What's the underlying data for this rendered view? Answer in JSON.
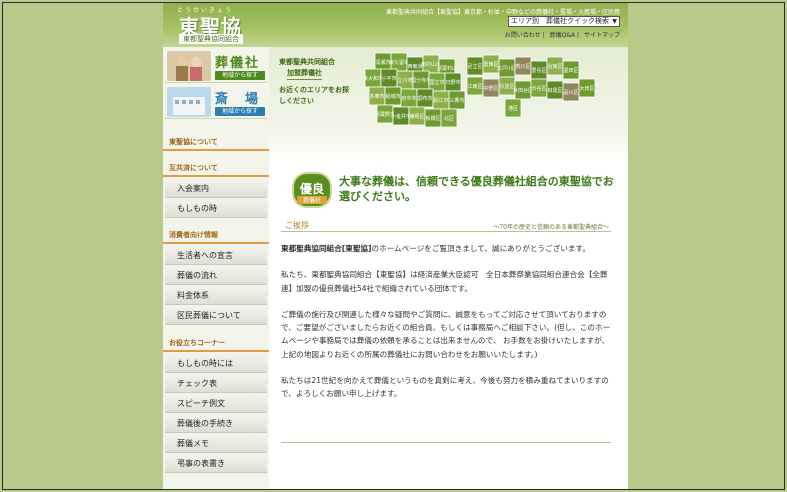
{
  "header": {
    "logo_ruby": "とうせいきょう",
    "logo": "東聖協",
    "logo_sub": "東都聖典協同組合",
    "tagline": "東都聖典共同組合【東聖協】東京都・杉並・中野などの葬儀社・霊場・火葬場・区民葬",
    "area_select": "エリア別　葬儀社クイック検索",
    "util_links": [
      "お問い合わせ",
      "葬儀Q&A",
      "サイトマップ"
    ]
  },
  "sidebar": {
    "promos": [
      {
        "title": "葬儀社",
        "sub": "地域から探す",
        "color": "#4f8a1c"
      },
      {
        "title": "斎　場",
        "sub": "地域から探す",
        "color": "#2e7db3"
      }
    ],
    "sections": [
      {
        "title": "東聖協について",
        "items": []
      },
      {
        "title": "互共済について",
        "items": [
          "入会案内",
          "もしもの時"
        ]
      },
      {
        "title": "消費者向け情報",
        "items": [
          "生活者への宣言",
          "葬儀の流れ",
          "料金体系",
          "区民葬儀について"
        ]
      },
      {
        "title": "お役立ちコーナー",
        "items": [
          "もしもの時には",
          "チェック表",
          "スピーチ例文",
          "葬儀後の手続き",
          "葬儀メモ",
          "弔事の表書き"
        ]
      }
    ]
  },
  "main": {
    "map_label_1": "東都聖典共同組合",
    "map_label_2": "加盟葬儀社",
    "map_guide": "お近くのエリアをお探しください",
    "badge_top": "優良",
    "badge_bottom": "葬儀社",
    "headline": "大事な葬儀は、信頼できる優良葬儀社組合の東聖協でお選びください。",
    "greeting_title": "ご挨拶",
    "greeting_sub": "〜70年の歴史と信頼のある東都聖典組合〜",
    "para1_bold": "東都聖典協同組合[東聖協]",
    "para1_rest": "のホームページをご覧頂きまして、誠にありがとうございます。",
    "para2": "私たち、東都聖典協同組合【東聖協】は経済産業大臣認可　全日本葬祭業協同組合連合会【全葬連】加盟の優良葬儀社54社で組織されている団体です。",
    "para3": "ご葬儀の施行及び関連した様々な疑問やご質問に、誠意をもってご対応させて頂いておりますので、ご要望がございましたらお近くの組合員、もしくは事務局へご相談下さい。(但し、このホームページや事務局では葬儀の依頼を承ることは出来ませんので、 お手数をお掛けいたしますが、上記の地図よりお近くの所属の葬儀社にお問い合わせをお願いいたします。)",
    "para4": "私たちは21世紀を向かえて葬儀というものを真剣に考え、今後も努力を積み重ねてまいりますので、よろしくお願い申し上げます。"
  },
  "map_regions": [
    "清瀬市",
    "東久留米",
    "西東京",
    "東村山市",
    "武蔵村山",
    "東大和市",
    "小平市",
    "立川市",
    "国分寺市",
    "国立市",
    "日野市",
    "多摩市",
    "稲城市",
    "府中市",
    "調布市",
    "狛江市",
    "三鷹市",
    "武蔵野市",
    "小金井市",
    "練馬区",
    "板橋区",
    "北区",
    "足立区",
    "葛飾区",
    "江戸川区",
    "荒川区",
    "豊島区",
    "台東区",
    "墨田区",
    "江東区",
    "中野区",
    "杉並区",
    "世田谷区",
    "渋谷区",
    "目黒区",
    "品川区",
    "大田区",
    "港区"
  ]
}
